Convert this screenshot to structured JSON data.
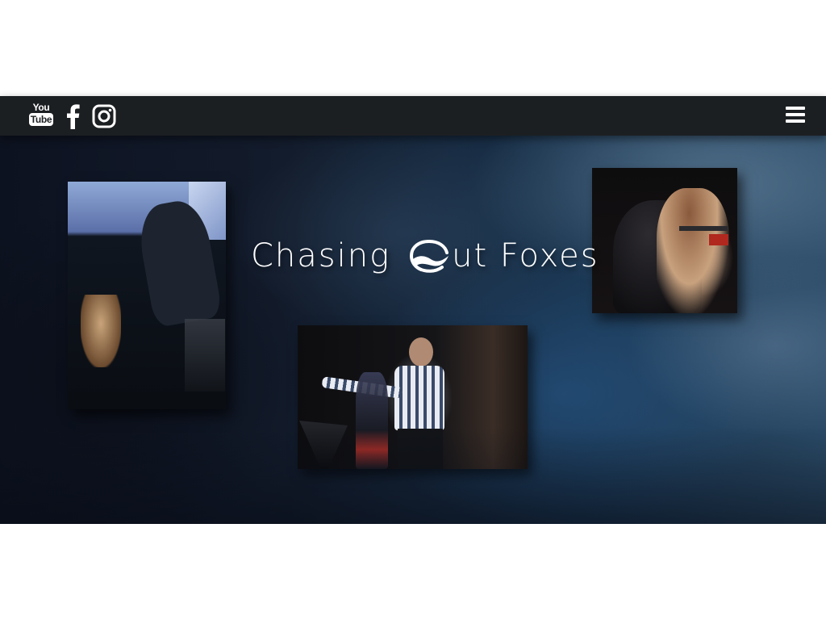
{
  "navbar": {
    "social": [
      {
        "name": "youtube-icon",
        "label_top": "You",
        "label_bottom": "Tube"
      },
      {
        "name": "facebook-icon"
      },
      {
        "name": "instagram-icon"
      }
    ],
    "menu_icon": "hamburger-menu-icon"
  },
  "hero": {
    "title_part_1": "Chasing",
    "title_logo_icon": "fox-logo-icon",
    "title_part_2": "ut Foxes",
    "photos": [
      {
        "name": "worship-leader-photo"
      },
      {
        "name": "singer-on-stage-photo"
      },
      {
        "name": "vocalists-photo"
      }
    ]
  },
  "colors": {
    "navbar_bg": "#1c1f22",
    "page_bg": "#ffffff",
    "text": "#ffffff"
  }
}
